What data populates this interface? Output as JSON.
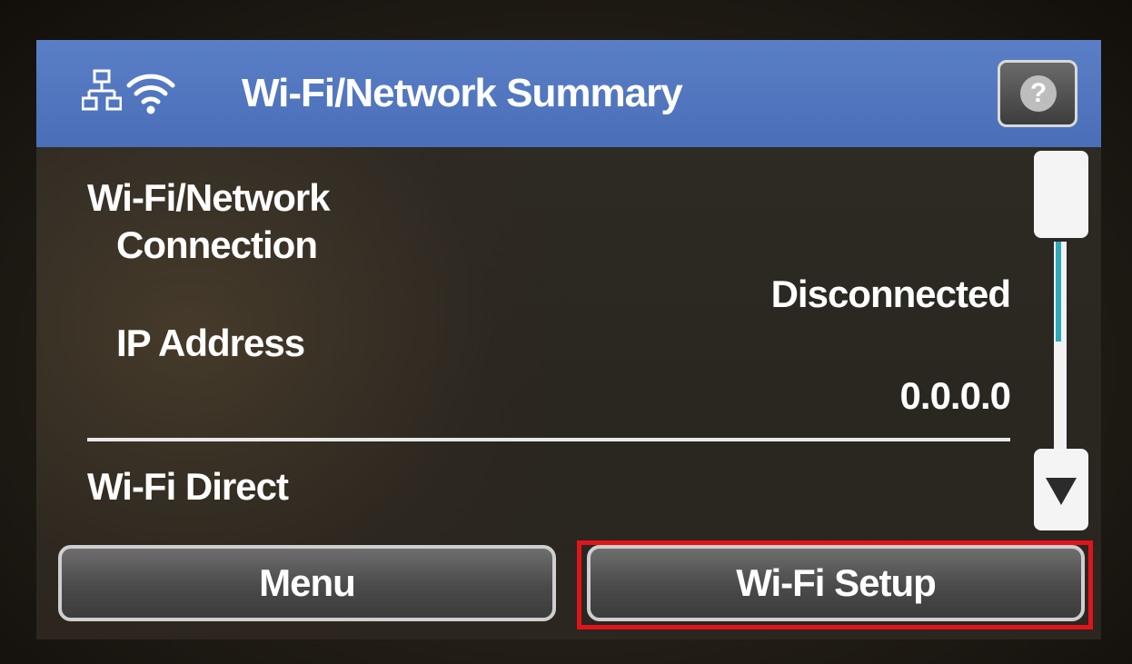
{
  "header": {
    "title": "Wi-Fi/Network Summary",
    "network_icon": "network-icon",
    "wifi_icon": "wifi-icon",
    "help_label": "?"
  },
  "rows": {
    "connection_label_line1": "Wi-Fi/Network",
    "connection_label_line2": "Connection",
    "connection_value": "Disconnected",
    "ip_label": "IP Address",
    "ip_value": "0.0.0.0",
    "direct_label": "Wi-Fi Direct"
  },
  "scrollbar": {
    "down_icon": "scroll-down-arrow-icon"
  },
  "buttons": {
    "menu_label": "Menu",
    "wifi_setup_label": "Wi-Fi Setup"
  },
  "colors": {
    "titlebar": "#4a6fb8",
    "highlight": "#e0141a",
    "accent": "#2fa8b8"
  }
}
